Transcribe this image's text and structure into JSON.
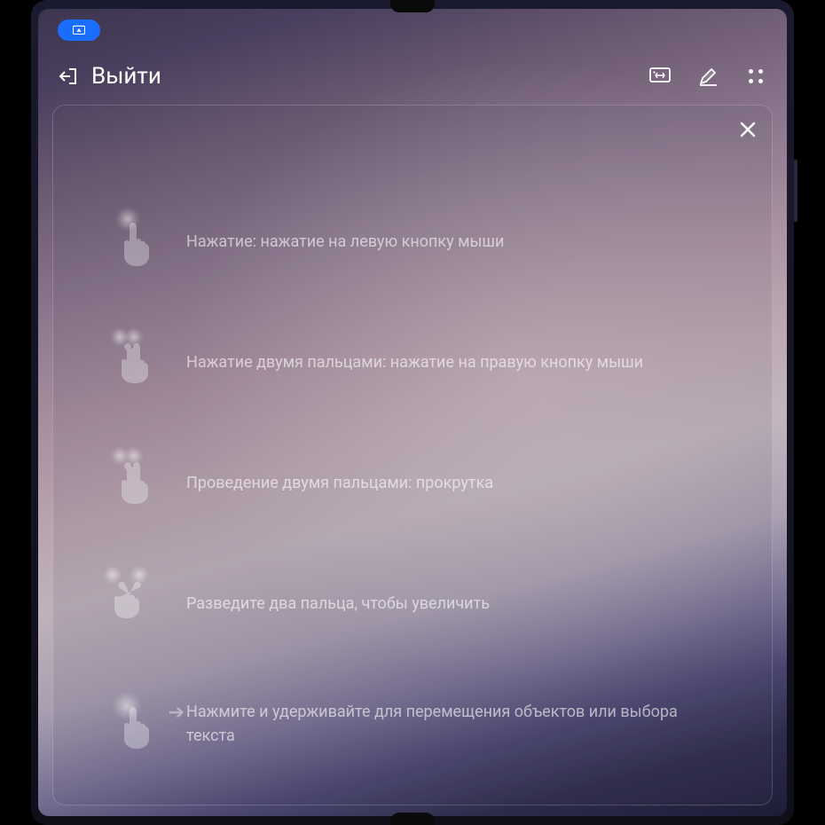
{
  "topbar": {
    "exit_label": "Выйти"
  },
  "gestures": [
    {
      "label": "Нажатие: нажатие на левую кнопку мыши"
    },
    {
      "label": "Нажатие двумя пальцами: нажатие на правую кнопку мыши"
    },
    {
      "label": "Проведение двумя пальцами: прокрутка"
    },
    {
      "label": "Разведите два пальца, чтобы увеличить"
    },
    {
      "label": "Нажмите и удерживайте для перемещения объектов или выбора текста"
    }
  ]
}
